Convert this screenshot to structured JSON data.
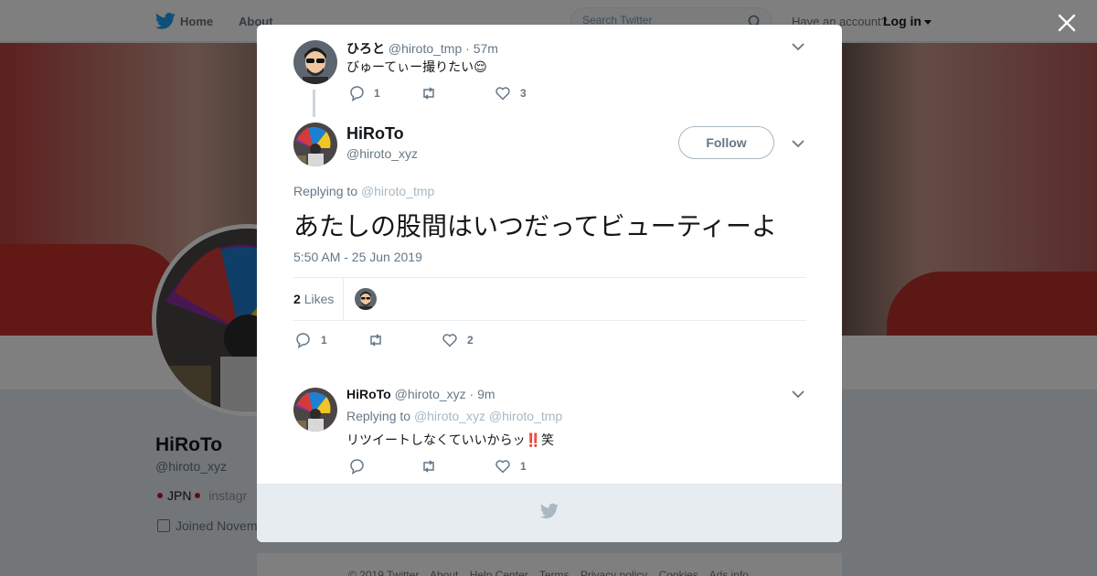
{
  "nav": {
    "home_label": "Home",
    "about_label": "About",
    "search_placeholder": "Search Twitter",
    "have_account": "Have an account?",
    "login_label": "Log in"
  },
  "profile": {
    "name": "HiRoTo",
    "handle": "@hiroto_xyz",
    "bio_country": "JPN",
    "bio_link": "instagr",
    "joined": "Joined Novem"
  },
  "footer": {
    "links": [
      "© 2019 Twitter",
      "About",
      "Help Center",
      "Terms",
      "Privacy policy",
      "Cookies",
      "Ads info"
    ]
  },
  "parent_tweet": {
    "name": "ひろと",
    "handle": "@hiroto_tmp",
    "time": "· 57m",
    "text": "びゅーてぃー撮りたい😌",
    "reply_count": "1",
    "retweet_count": "",
    "like_count": "3"
  },
  "main_tweet": {
    "name": "HiRoTo",
    "handle": "@hiroto_xyz",
    "follow_label": "Follow",
    "replying_prefix": "Replying to",
    "replying_to": "@hiroto_tmp",
    "text": "あたしの股間はいつだってビューティーよ",
    "timestamp": "5:50 AM - 25 Jun 2019",
    "likes_count": "2",
    "likes_label": "Likes",
    "reply_count": "1",
    "retweet_count": "",
    "like_count": "2"
  },
  "reply_tweet": {
    "name": "HiRoTo",
    "handle": "@hiroto_xyz",
    "time": "· 9m",
    "replying_prefix": "Replying to",
    "replying_to_1": "@hiroto_xyz",
    "replying_to_2": "@hiroto_tmp",
    "text": "リツイートしなくていいからッ‼️笑",
    "reply_count": "",
    "retweet_count": "",
    "like_count": "1"
  },
  "colors": {
    "brand": "#1da1f2",
    "text_secondary": "#657786",
    "overlay": "rgba(0,0,0,0.5)"
  },
  "icons": [
    "twitter-bird-icon",
    "search-icon",
    "close-icon",
    "chevron-down-icon",
    "reply-icon",
    "retweet-icon",
    "like-icon",
    "calendar-icon"
  ]
}
